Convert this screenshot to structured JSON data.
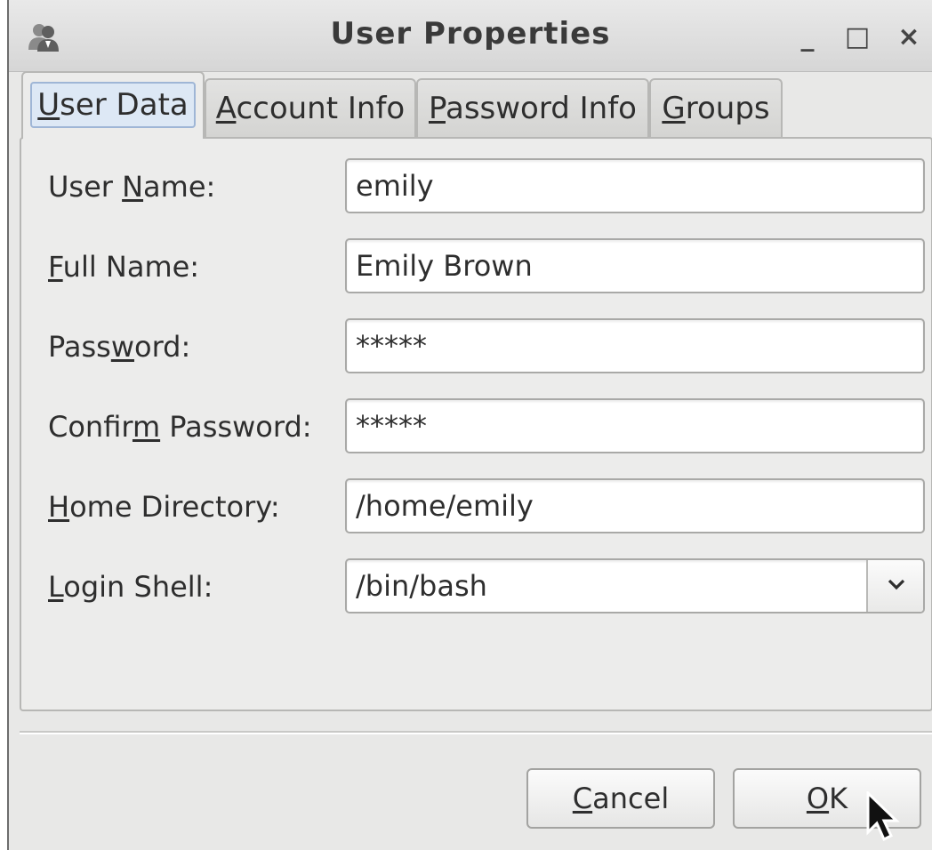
{
  "window": {
    "title": "User Properties",
    "min_glyph": "_",
    "max_glyph": "□",
    "close_glyph": "×",
    "icon": "users-icon"
  },
  "tabs": [
    {
      "pre": "",
      "key": "U",
      "post": "ser Data",
      "active": true
    },
    {
      "pre": "",
      "key": "A",
      "post": "ccount Info",
      "active": false
    },
    {
      "pre": "",
      "key": "P",
      "post": "assword Info",
      "active": false
    },
    {
      "pre": "",
      "key": "G",
      "post": "roups",
      "active": false
    }
  ],
  "form": {
    "user_name": {
      "pre": "User ",
      "key": "N",
      "post": "ame:",
      "value": "emily"
    },
    "full_name": {
      "pre": "",
      "key": "F",
      "post": "ull Name:",
      "value": "Emily Brown"
    },
    "password": {
      "pre": "Pass",
      "key": "w",
      "post": "ord:",
      "value": "*****"
    },
    "confirm_password": {
      "pre": "Confir",
      "key": "m",
      "post": " Password:",
      "value": "*****"
    },
    "home_directory": {
      "pre": "",
      "key": "H",
      "post": "ome Directory:",
      "value": "/home/emily"
    },
    "login_shell": {
      "pre": "",
      "key": "L",
      "post": "ogin Shell:",
      "value": "/bin/bash",
      "dropdown_icon": "chevron-down-icon"
    }
  },
  "buttons": {
    "cancel": {
      "pre": "",
      "key": "C",
      "post": "ancel"
    },
    "ok": {
      "pre": "",
      "key": "O",
      "post": "K"
    }
  }
}
